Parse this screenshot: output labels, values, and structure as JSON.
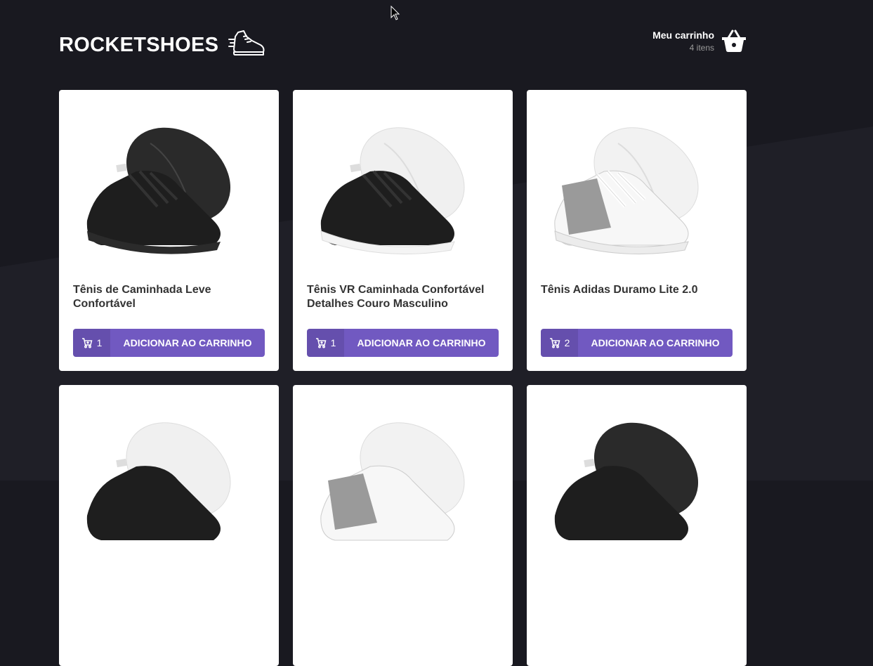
{
  "brand": {
    "name": "ROCKETSHOES",
    "logo_icon": "sneaker-icon"
  },
  "cart": {
    "title": "Meu carrinho",
    "count_label": "4 itens",
    "icon": "basket-icon"
  },
  "products": [
    {
      "title": "Tênis de Caminhada Leve Confortável",
      "amount": "1",
      "button_label": "ADICIONAR AO CARRINHO",
      "shoe_color": "black"
    },
    {
      "title": "Tênis VR Caminhada Confortável Detalhes Couro Masculino",
      "amount": "1",
      "button_label": "ADICIONAR AO CARRINHO",
      "shoe_color": "black-white"
    },
    {
      "title": "Tênis Adidas Duramo Lite 2.0",
      "amount": "2",
      "button_label": "ADICIONAR AO CARRINHO",
      "shoe_color": "white-gray"
    },
    {
      "title": "",
      "amount": "",
      "button_label": "",
      "shoe_color": "black-white"
    },
    {
      "title": "",
      "amount": "",
      "button_label": "",
      "shoe_color": "white-gray"
    },
    {
      "title": "",
      "amount": "",
      "button_label": "",
      "shoe_color": "black"
    }
  ],
  "colors": {
    "background": "#191920",
    "accent": "#7159c1",
    "card": "#ffffff"
  }
}
